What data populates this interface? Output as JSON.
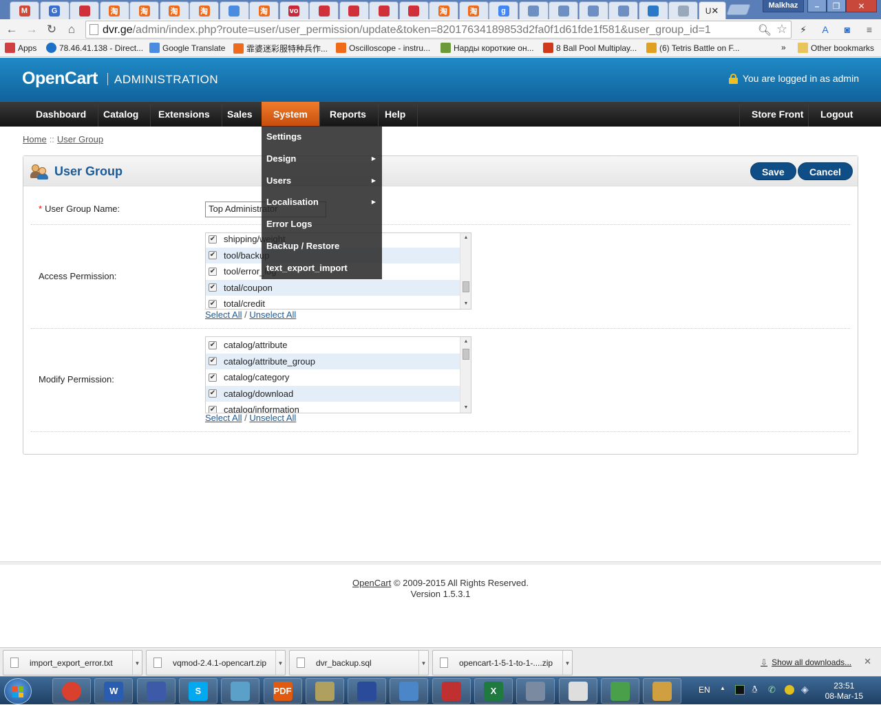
{
  "browser": {
    "tabs": [
      {
        "icon": "gmail-icon",
        "label": "M",
        "color": "#d14836"
      },
      {
        "icon": "g-icon",
        "label": "G",
        "color": "#3a6ecf"
      },
      {
        "icon": "shop-icon",
        "label": "",
        "color": "#d0303a"
      },
      {
        "icon": "taobao-icon",
        "label": "淘",
        "color": "#ef6a1a"
      },
      {
        "icon": "taobao-icon",
        "label": "淘",
        "color": "#ef6a1a"
      },
      {
        "icon": "taobao-icon",
        "label": "淘",
        "color": "#ef6a1a"
      },
      {
        "icon": "taobao-icon",
        "label": "淘",
        "color": "#ef6a1a"
      },
      {
        "icon": "translate-icon",
        "label": "",
        "color": "#4a8cdf"
      },
      {
        "icon": "taobao-icon",
        "label": "淘",
        "color": "#ef6a1a"
      },
      {
        "icon": "vo-icon",
        "label": "vo",
        "color": "#c7283a"
      },
      {
        "icon": "shop-icon",
        "label": "",
        "color": "#d0303a"
      },
      {
        "icon": "shop-icon",
        "label": "",
        "color": "#d0303a"
      },
      {
        "icon": "shop-icon",
        "label": "",
        "color": "#d0303a"
      },
      {
        "icon": "shop-icon",
        "label": "",
        "color": "#d0303a"
      },
      {
        "icon": "taobao-icon",
        "label": "淘",
        "color": "#ef6a1a"
      },
      {
        "icon": "taobao-icon",
        "label": "淘",
        "color": "#ef6a1a"
      },
      {
        "icon": "google-icon",
        "label": "g",
        "color": "#4285f4"
      },
      {
        "icon": "cart-icon",
        "label": "",
        "color": "#6d8fc2"
      },
      {
        "icon": "cart-icon",
        "label": "",
        "color": "#6d8fc2"
      },
      {
        "icon": "cart-icon",
        "label": "",
        "color": "#6d8fc2"
      },
      {
        "icon": "cart-icon",
        "label": "",
        "color": "#6d8fc2"
      },
      {
        "icon": "globe-icon",
        "label": "",
        "color": "#2a78c8"
      },
      {
        "icon": "page-icon",
        "label": "",
        "color": "#9aa8bb"
      }
    ],
    "active_tab_label": "U",
    "window_user": "Malkhaz",
    "url_host": "dvr.ge",
    "url_path": "/admin/index.php?route=user/user_permission/update&token=82017634189853d2fa0f1d61fde1f581&user_group_id=1",
    "bookmarks": [
      {
        "label": "Apps",
        "icon": "apps-icon",
        "color": "#d04040"
      },
      {
        "label": "78.46.41.138 - Direct...",
        "icon": "globe-icon",
        "color": "#1b70c8"
      },
      {
        "label": "Google Translate",
        "icon": "translate-icon",
        "color": "#4a8cdf"
      },
      {
        "label": "霏婆迷彩服特种兵作...",
        "icon": "taobao-icon",
        "color": "#ef6a1a"
      },
      {
        "label": "Oscilloscope - instru...",
        "icon": "taobao-icon",
        "color": "#ef6a1a"
      },
      {
        "label": "Нарды короткие он...",
        "icon": "game-icon",
        "color": "#6a9a3a"
      },
      {
        "label": "8 Ball Pool Multiplay...",
        "icon": "play-icon",
        "color": "#d03a1a"
      },
      {
        "label": "(6) Tetris Battle on F...",
        "icon": "tetris-icon",
        "color": "#e0a020"
      }
    ],
    "bookmarks_more": "»",
    "other_bookmarks": "Other bookmarks"
  },
  "header": {
    "logo": "OpenCart",
    "admin_label": "ADMINISTRATION",
    "logged_in": "You are logged in as admin"
  },
  "menu": {
    "items": [
      "Dashboard",
      "Catalog",
      "Extensions",
      "Sales",
      "System",
      "Reports",
      "Help"
    ],
    "active": "System",
    "right": [
      "Store Front",
      "Logout"
    ]
  },
  "system_dropdown": [
    {
      "label": "Settings",
      "submenu": false
    },
    {
      "label": "Design",
      "submenu": true
    },
    {
      "label": "Users",
      "submenu": true
    },
    {
      "label": "Localisation",
      "submenu": true
    },
    {
      "label": "Error Logs",
      "submenu": false
    },
    {
      "label": "Backup / Restore",
      "submenu": false
    },
    {
      "label": "text_export_import",
      "submenu": false
    }
  ],
  "breadcrumb": {
    "home": "Home",
    "sep": "::",
    "current": "User Group"
  },
  "form": {
    "title": "User Group",
    "save": "Save",
    "cancel": "Cancel",
    "name_label": "User Group Name:",
    "required_mark": "*",
    "name_value": "Top Administrator",
    "access_label": "Access Permission:",
    "modify_label": "Modify Permission:",
    "access_items": [
      "shipping/weight",
      "tool/backup",
      "tool/error_log",
      "total/coupon",
      "total/credit"
    ],
    "modify_items": [
      "catalog/attribute",
      "catalog/attribute_group",
      "catalog/category",
      "catalog/download",
      "catalog/information"
    ],
    "select_all": "Select All",
    "link_sep": "/",
    "unselect_all": "Unselect All"
  },
  "footer": {
    "brand": "OpenCart",
    "copyright": "© 2009-2015 All Rights Reserved.",
    "version": "Version 1.5.3.1"
  },
  "downloads": {
    "files": [
      "import_export_error.txt",
      "vqmod-2.4.1-opencart.zip",
      "dvr_backup.sql",
      "opencart-1-5-1-to-1-....zip"
    ],
    "show_all": "Show all downloads..."
  },
  "taskbar": {
    "apps": [
      {
        "icon": "chrome-icon",
        "label": "",
        "color": "#d9412e"
      },
      {
        "icon": "word-icon",
        "label": "W",
        "color": "#2a5db0"
      },
      {
        "icon": "floppy-icon",
        "label": "",
        "color": "#3c5aa8"
      },
      {
        "icon": "skype-icon",
        "label": "S",
        "color": "#00a9f0"
      },
      {
        "icon": "calculator-icon",
        "label": "",
        "color": "#5aa0c8"
      },
      {
        "icon": "pdf-icon",
        "label": "PDF",
        "color": "#e05a10"
      },
      {
        "icon": "pen-icon",
        "label": "",
        "color": "#b0a060"
      },
      {
        "icon": "remote-desktop-icon",
        "label": "",
        "color": "#2a4a9a"
      },
      {
        "icon": "control-panel-icon",
        "label": "",
        "color": "#4a86c8"
      },
      {
        "icon": "toolbox-icon",
        "label": "",
        "color": "#c03030"
      },
      {
        "icon": "excel-icon",
        "label": "X",
        "color": "#1e7a3e"
      },
      {
        "icon": "devices-icon",
        "label": "",
        "color": "#7a8aa0"
      },
      {
        "icon": "notepad-icon",
        "label": "",
        "color": "#dedede"
      },
      {
        "icon": "paint-icon",
        "label": "",
        "color": "#4aa04a"
      },
      {
        "icon": "edit-icon",
        "label": "",
        "color": "#d0a040"
      }
    ],
    "language": "EN",
    "time": "23:51",
    "date": "08-Mar-15"
  }
}
